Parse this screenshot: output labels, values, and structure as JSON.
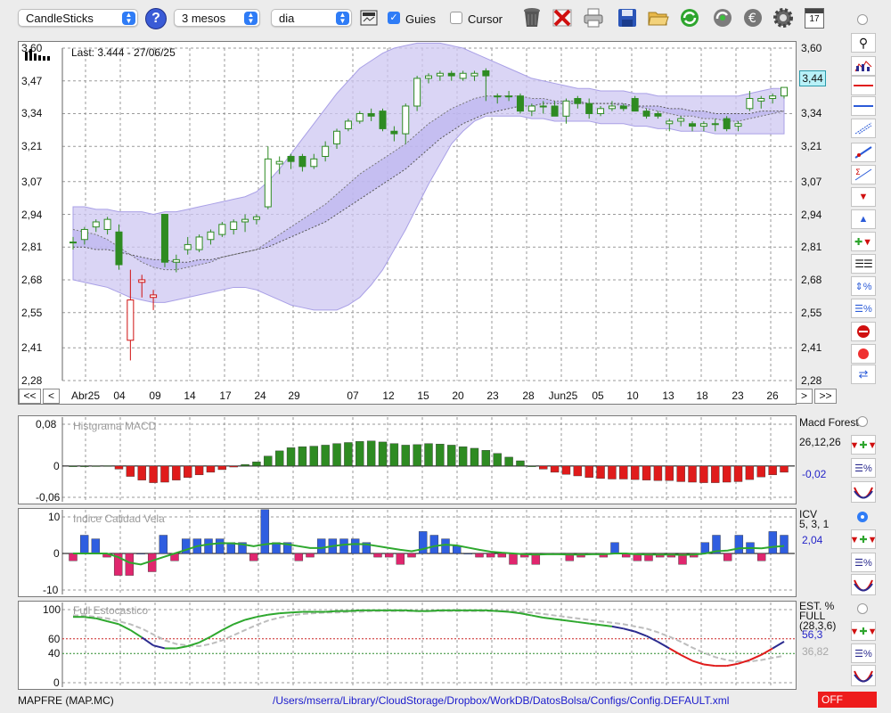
{
  "toolbar": {
    "chart_type": "CandleSticks",
    "period": "3 mesos",
    "interval": "dia",
    "guides_label": "Guies",
    "guides_checked": true,
    "cursor_label": "Cursor",
    "cursor_checked": false,
    "help_glyph": "?",
    "icons": [
      "calculator-icon",
      "trash-icon",
      "delete-icon",
      "print-icon",
      "save-icon",
      "open-folder-icon",
      "refresh-icon",
      "update-icon",
      "currency-icon",
      "gear-icon",
      "calendar-icon"
    ],
    "calendar_day": "17"
  },
  "main_chart": {
    "last_label": "Last: 3.444 - 27/06/25",
    "last_badge": "3,44",
    "y_ticks": [
      "3,60",
      "3,47",
      "3,34",
      "3,21",
      "3,07",
      "2,94",
      "2,81",
      "2,68",
      "2,55",
      "2,41",
      "2,28"
    ],
    "x_ticks": [
      "Abr25",
      "04",
      "09",
      "14",
      "17",
      "24",
      "29",
      "07",
      "12",
      "15",
      "20",
      "23",
      "28",
      "Jun25",
      "05",
      "10",
      "13",
      "18",
      "23",
      "26"
    ],
    "nav": {
      "first": "<<",
      "prev": "<",
      "next": ">",
      "last": ">>"
    }
  },
  "chart_data": [
    {
      "type": "candlestick",
      "title": "",
      "ylim": [
        2.28,
        3.6
      ],
      "colors": {
        "up": "#ffffff",
        "down": "#2e8b22",
        "band": "#c9c3f0"
      },
      "candles": [
        {
          "o": 2.83,
          "h": 2.85,
          "l": 2.8,
          "c": 2.83
        },
        {
          "o": 2.84,
          "h": 2.89,
          "l": 2.82,
          "c": 2.88
        },
        {
          "o": 2.89,
          "h": 2.92,
          "l": 2.87,
          "c": 2.91
        },
        {
          "o": 2.88,
          "h": 2.93,
          "l": 2.86,
          "c": 2.92
        },
        {
          "o": 2.87,
          "h": 2.9,
          "l": 2.72,
          "c": 2.74
        },
        {
          "o": 2.44,
          "h": 2.72,
          "l": 2.36,
          "c": 2.6
        },
        {
          "o": 2.67,
          "h": 2.7,
          "l": 2.61,
          "c": 2.68
        },
        {
          "o": 2.61,
          "h": 2.64,
          "l": 2.56,
          "c": 2.62
        },
        {
          "o": 2.94,
          "h": 2.94,
          "l": 2.73,
          "c": 2.75
        },
        {
          "o": 2.75,
          "h": 2.78,
          "l": 2.71,
          "c": 2.76
        },
        {
          "o": 2.8,
          "h": 2.85,
          "l": 2.78,
          "c": 2.82
        },
        {
          "o": 2.8,
          "h": 2.86,
          "l": 2.79,
          "c": 2.85
        },
        {
          "o": 2.84,
          "h": 2.88,
          "l": 2.82,
          "c": 2.87
        },
        {
          "o": 2.86,
          "h": 2.91,
          "l": 2.85,
          "c": 2.9
        },
        {
          "o": 2.88,
          "h": 2.92,
          "l": 2.86,
          "c": 2.91
        },
        {
          "o": 2.91,
          "h": 2.94,
          "l": 2.87,
          "c": 2.92
        },
        {
          "o": 2.92,
          "h": 2.94,
          "l": 2.9,
          "c": 2.93
        },
        {
          "o": 2.97,
          "h": 3.21,
          "l": 2.96,
          "c": 3.16
        },
        {
          "o": 3.14,
          "h": 3.17,
          "l": 3.1,
          "c": 3.15
        },
        {
          "o": 3.17,
          "h": 3.18,
          "l": 3.12,
          "c": 3.15
        },
        {
          "o": 3.17,
          "h": 3.18,
          "l": 3.11,
          "c": 3.13
        },
        {
          "o": 3.13,
          "h": 3.18,
          "l": 3.12,
          "c": 3.16
        },
        {
          "o": 3.17,
          "h": 3.23,
          "l": 3.15,
          "c": 3.21
        },
        {
          "o": 3.22,
          "h": 3.28,
          "l": 3.2,
          "c": 3.27
        },
        {
          "o": 3.28,
          "h": 3.32,
          "l": 3.27,
          "c": 3.31
        },
        {
          "o": 3.31,
          "h": 3.35,
          "l": 3.3,
          "c": 3.34
        },
        {
          "o": 3.34,
          "h": 3.36,
          "l": 3.31,
          "c": 3.33
        },
        {
          "o": 3.35,
          "h": 3.36,
          "l": 3.27,
          "c": 3.28
        },
        {
          "o": 3.27,
          "h": 3.29,
          "l": 3.23,
          "c": 3.26
        },
        {
          "o": 3.26,
          "h": 3.38,
          "l": 3.22,
          "c": 3.37
        },
        {
          "o": 3.37,
          "h": 3.49,
          "l": 3.35,
          "c": 3.48
        },
        {
          "o": 3.48,
          "h": 3.5,
          "l": 3.46,
          "c": 3.49
        },
        {
          "o": 3.49,
          "h": 3.51,
          "l": 3.47,
          "c": 3.5
        },
        {
          "o": 3.5,
          "h": 3.51,
          "l": 3.47,
          "c": 3.49
        },
        {
          "o": 3.48,
          "h": 3.51,
          "l": 3.47,
          "c": 3.5
        },
        {
          "o": 3.49,
          "h": 3.51,
          "l": 3.47,
          "c": 3.5
        },
        {
          "o": 3.51,
          "h": 3.52,
          "l": 3.39,
          "c": 3.49
        },
        {
          "o": 3.41,
          "h": 3.42,
          "l": 3.38,
          "c": 3.41
        },
        {
          "o": 3.41,
          "h": 3.43,
          "l": 3.39,
          "c": 3.41
        },
        {
          "o": 3.41,
          "h": 3.42,
          "l": 3.34,
          "c": 3.35
        },
        {
          "o": 3.35,
          "h": 3.38,
          "l": 3.33,
          "c": 3.37
        },
        {
          "o": 3.37,
          "h": 3.39,
          "l": 3.34,
          "c": 3.37
        },
        {
          "o": 3.37,
          "h": 3.39,
          "l": 3.33,
          "c": 3.33
        },
        {
          "o": 3.33,
          "h": 3.4,
          "l": 3.3,
          "c": 3.39
        },
        {
          "o": 3.4,
          "h": 3.41,
          "l": 3.36,
          "c": 3.38
        },
        {
          "o": 3.38,
          "h": 3.4,
          "l": 3.32,
          "c": 3.34
        },
        {
          "o": 3.34,
          "h": 3.37,
          "l": 3.33,
          "c": 3.36
        },
        {
          "o": 3.36,
          "h": 3.39,
          "l": 3.35,
          "c": 3.37
        },
        {
          "o": 3.37,
          "h": 3.38,
          "l": 3.35,
          "c": 3.36
        },
        {
          "o": 3.4,
          "h": 3.41,
          "l": 3.35,
          "c": 3.35
        },
        {
          "o": 3.35,
          "h": 3.36,
          "l": 3.32,
          "c": 3.33
        },
        {
          "o": 3.34,
          "h": 3.35,
          "l": 3.32,
          "c": 3.33
        },
        {
          "o": 3.3,
          "h": 3.32,
          "l": 3.27,
          "c": 3.31
        },
        {
          "o": 3.31,
          "h": 3.33,
          "l": 3.29,
          "c": 3.32
        },
        {
          "o": 3.3,
          "h": 3.31,
          "l": 3.27,
          "c": 3.29
        },
        {
          "o": 3.29,
          "h": 3.31,
          "l": 3.27,
          "c": 3.3
        },
        {
          "o": 3.3,
          "h": 3.32,
          "l": 3.27,
          "c": 3.3
        },
        {
          "o": 3.32,
          "h": 3.33,
          "l": 3.27,
          "c": 3.28
        },
        {
          "o": 3.29,
          "h": 3.31,
          "l": 3.27,
          "c": 3.3
        },
        {
          "o": 3.36,
          "h": 3.43,
          "l": 3.35,
          "c": 3.4
        },
        {
          "o": 3.39,
          "h": 3.41,
          "l": 3.36,
          "c": 3.4
        },
        {
          "o": 3.4,
          "h": 3.42,
          "l": 3.38,
          "c": 3.41
        },
        {
          "o": 3.41,
          "h": 3.44,
          "l": 3.4,
          "c": 3.444
        }
      ],
      "sma_short": [
        2.88,
        2.87,
        2.86,
        2.84,
        2.81,
        2.78,
        2.75,
        2.73,
        2.72,
        2.72,
        2.73,
        2.74,
        2.75,
        2.77,
        2.78,
        2.79,
        2.8,
        2.83,
        2.86,
        2.89,
        2.92,
        2.95,
        2.98,
        3.02,
        3.06,
        3.1,
        3.13,
        3.16,
        3.19,
        3.22,
        3.26,
        3.3,
        3.33,
        3.36,
        3.38,
        3.4,
        3.41,
        3.41,
        3.41,
        3.41,
        3.4,
        3.4,
        3.39,
        3.39,
        3.39,
        3.38,
        3.38,
        3.38,
        3.37,
        3.37,
        3.36,
        3.35,
        3.34,
        3.33,
        3.33,
        3.32,
        3.32,
        3.31,
        3.31,
        3.32,
        3.33,
        3.34,
        3.35
      ],
      "sma_long": [
        2.81,
        2.81,
        2.8,
        2.8,
        2.79,
        2.78,
        2.77,
        2.76,
        2.76,
        2.75,
        2.75,
        2.76,
        2.76,
        2.77,
        2.78,
        2.79,
        2.8,
        2.81,
        2.83,
        2.85,
        2.87,
        2.89,
        2.91,
        2.94,
        2.97,
        3.0,
        3.03,
        3.06,
        3.09,
        3.12,
        3.16,
        3.2,
        3.24,
        3.27,
        3.3,
        3.32,
        3.34,
        3.35,
        3.36,
        3.37,
        3.37,
        3.38,
        3.38,
        3.38,
        3.38,
        3.38,
        3.38,
        3.38,
        3.38,
        3.37,
        3.37,
        3.37,
        3.36,
        3.36,
        3.35,
        3.35,
        3.34,
        3.34,
        3.34,
        3.34,
        3.35,
        3.35,
        3.35
      ],
      "band_upper": [
        2.97,
        2.97,
        2.96,
        2.96,
        2.95,
        2.95,
        2.95,
        2.94,
        2.95,
        2.95,
        2.96,
        2.97,
        2.98,
        2.99,
        3.0,
        3.01,
        3.03,
        3.07,
        3.12,
        3.18,
        3.24,
        3.3,
        3.36,
        3.42,
        3.47,
        3.52,
        3.55,
        3.58,
        3.6,
        3.61,
        3.62,
        3.62,
        3.62,
        3.61,
        3.6,
        3.58,
        3.56,
        3.54,
        3.52,
        3.5,
        3.48,
        3.47,
        3.46,
        3.45,
        3.44,
        3.44,
        3.43,
        3.43,
        3.43,
        3.42,
        3.42,
        3.41,
        3.41,
        3.41,
        3.41,
        3.41,
        3.41,
        3.41,
        3.41,
        3.42,
        3.43,
        3.44,
        3.44
      ],
      "band_lower": [
        2.68,
        2.67,
        2.66,
        2.65,
        2.63,
        2.61,
        2.6,
        2.59,
        2.59,
        2.6,
        2.61,
        2.62,
        2.63,
        2.64,
        2.65,
        2.65,
        2.64,
        2.62,
        2.6,
        2.58,
        2.57,
        2.56,
        2.56,
        2.56,
        2.58,
        2.61,
        2.66,
        2.72,
        2.8,
        2.88,
        2.97,
        3.06,
        3.14,
        3.22,
        3.27,
        3.31,
        3.33,
        3.33,
        3.33,
        3.33,
        3.32,
        3.32,
        3.31,
        3.31,
        3.31,
        3.31,
        3.3,
        3.3,
        3.3,
        3.29,
        3.29,
        3.28,
        3.28,
        3.27,
        3.27,
        3.27,
        3.26,
        3.26,
        3.26,
        3.26,
        3.26,
        3.26,
        3.26
      ]
    },
    {
      "type": "bar",
      "title": "Histgrama MACD",
      "y_ticks": [
        "0,08",
        "0",
        "-0,06"
      ],
      "ylim": [
        -0.06,
        0.08
      ],
      "legend": {
        "name": "Macd Forest",
        "params": "26,12,26",
        "value": "-0,02"
      },
      "colors": {
        "pos": "#2e8b22",
        "neg": "#e01b1b"
      },
      "values": [
        0,
        0,
        0.0003,
        0.0005,
        -0.006,
        -0.02,
        -0.027,
        -0.032,
        -0.031,
        -0.027,
        -0.022,
        -0.017,
        -0.012,
        -0.007,
        -0.002,
        0.003,
        0.008,
        0.019,
        0.029,
        0.035,
        0.037,
        0.038,
        0.04,
        0.043,
        0.045,
        0.047,
        0.048,
        0.046,
        0.043,
        0.04,
        0.041,
        0.043,
        0.042,
        0.04,
        0.037,
        0.034,
        0.03,
        0.024,
        0.017,
        0.01,
        0,
        -0.006,
        -0.012,
        -0.016,
        -0.019,
        -0.022,
        -0.024,
        -0.025,
        -0.025,
        -0.026,
        -0.027,
        -0.028,
        -0.028,
        -0.03,
        -0.031,
        -0.032,
        -0.032,
        -0.031,
        -0.03,
        -0.026,
        -0.021,
        -0.017,
        -0.012
      ]
    },
    {
      "type": "bar",
      "title": "Indice Calidad Vela",
      "y_ticks": [
        "10",
        "0",
        "-10"
      ],
      "ylim": [
        -10,
        10
      ],
      "legend": {
        "name": "ICV",
        "params": "5, 3, 1",
        "value": "2,04"
      },
      "colors": {
        "pos": "#2f5ee0",
        "neg": "#e0266e",
        "line": "#2ea82e"
      },
      "values": [
        -2,
        5,
        4,
        -1,
        -6,
        -6,
        0,
        -5,
        5,
        -2,
        4,
        4,
        4,
        4,
        3,
        3,
        -2,
        12,
        3,
        3,
        -2,
        -1,
        4,
        4,
        4,
        4,
        3,
        -1,
        -1,
        -3,
        -1,
        6,
        5,
        4,
        2,
        0,
        -1,
        -1,
        -1,
        -3,
        -1,
        -3,
        0,
        0,
        -2,
        -1,
        0,
        -1,
        3,
        -1,
        -2,
        -2,
        -1,
        -1,
        -3,
        -1,
        3,
        5,
        -2,
        5,
        3,
        -2,
        6,
        5
      ],
      "line": [
        0,
        0,
        0,
        0,
        -1,
        -2.5,
        -3,
        -2,
        -1,
        0,
        1,
        2,
        2.5,
        2.8,
        2.8,
        2.5,
        2,
        2.5,
        2.8,
        2.5,
        2,
        1.5,
        1.5,
        2,
        2.4,
        2.6,
        2.5,
        2,
        1.5,
        1,
        0.6,
        1.2,
        2,
        2.4,
        2.2,
        1.6,
        1,
        0.5,
        0.2,
        0,
        -0.2,
        -0.3,
        -0.2,
        -0.2,
        -0.3,
        -0.3,
        -0.2,
        -0.2,
        0,
        0,
        -0.2,
        -0.3,
        -0.3,
        -0.3,
        -0.4,
        -0.3,
        0,
        0.6,
        0.8,
        1.4,
        1.5,
        1.4,
        1.8,
        2.04
      ]
    },
    {
      "type": "line",
      "title": "Full Estocastico",
      "y_ticks": [
        "100",
        "60",
        "40",
        "0"
      ],
      "ylim": [
        0,
        100
      ],
      "legend": {
        "name": "EST. %",
        "subname": "FULL",
        "params": "(28,3,6)",
        "value": "56,3",
        "value2": "36,82"
      },
      "colors": {
        "k_mid": "#2ea82e",
        "k_high": "#2ea82e",
        "k_low": "#e01b1b",
        "k_fall": "#2b2b8f",
        "d": "#bdbdbd"
      },
      "k": [
        90,
        90,
        88,
        84,
        80,
        72,
        62,
        51,
        47,
        47,
        50,
        55,
        63,
        72,
        80,
        86,
        90,
        93,
        95,
        96,
        97,
        97,
        97,
        98,
        98,
        99,
        99,
        99,
        99,
        99,
        98,
        98,
        99,
        99,
        99,
        99,
        99,
        98,
        97,
        95,
        92,
        89,
        87,
        85,
        83,
        81,
        79,
        77,
        74,
        70,
        64,
        56,
        47,
        38,
        30,
        25,
        23,
        23,
        26,
        31,
        38,
        47,
        56.3
      ],
      "d": [
        92,
        92,
        90,
        88,
        84,
        80,
        74,
        66,
        58,
        53,
        51,
        50,
        53,
        58,
        65,
        72,
        79,
        85,
        89,
        92,
        94,
        95,
        96,
        96,
        97,
        97,
        98,
        98,
        98,
        98,
        98,
        98,
        98,
        98,
        98,
        98,
        98,
        98,
        98,
        97,
        96,
        94,
        92,
        90,
        88,
        86,
        84,
        82,
        80,
        77,
        74,
        69,
        63,
        56,
        48,
        41,
        35,
        31,
        29,
        29,
        31,
        34,
        36.82
      ]
    }
  ],
  "right_tools": [
    "magnifier-icon",
    "candles-icon",
    "horizontal-line-red-icon",
    "horizontal-line-blue-icon",
    "channel-icon",
    "trend-line-icon",
    "fibonacci-icon",
    "arrow-down-icon",
    "arrow-up-icon",
    "add-signal-icon",
    "grid-icon",
    "scale-percent-icon",
    "log-percent-icon",
    "stop-icon",
    "record-icon",
    "swap-icon"
  ],
  "footer": {
    "ticker": "MAPFRE (MAP.MC)",
    "config_path": "/Users/mserra/Library/CloudStorage/Dropbox/WorkDB/DatosBolsa/Configs/Config.DEFAULT.xml",
    "status": "OFF"
  }
}
